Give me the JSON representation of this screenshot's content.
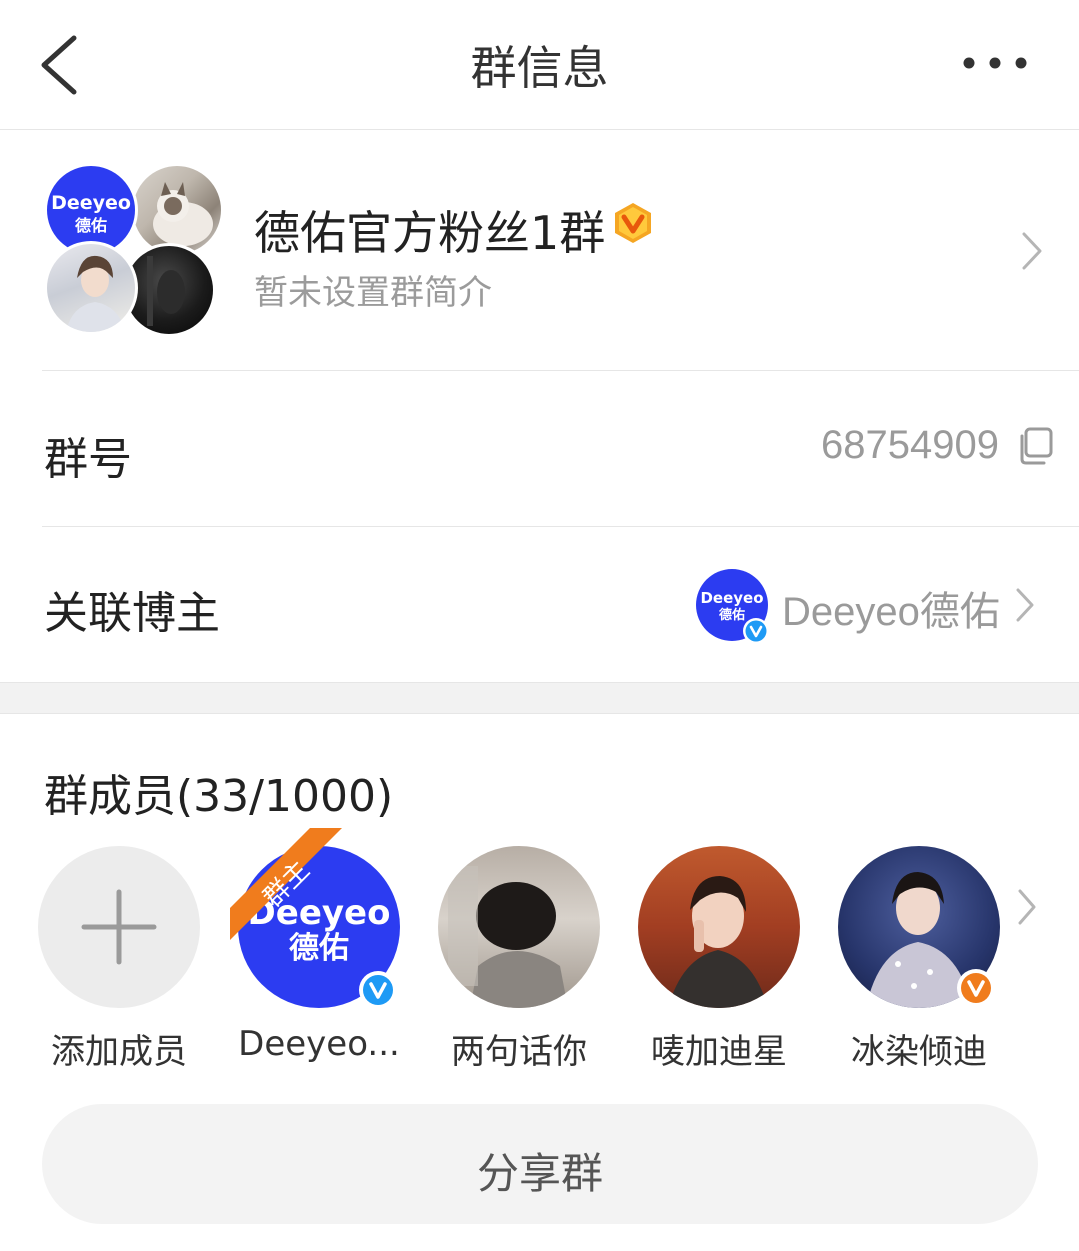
{
  "header": {
    "title": "群信息",
    "back_icon": "chevron-left-icon",
    "more_icon": "more-dots-icon"
  },
  "group": {
    "name": "德佑官方粉丝1群",
    "description": "暂未设置群简介",
    "badge_icon": "vip-v-badge-icon",
    "badge_color": "#f5a623",
    "avatar_brand_line1": "Deeyeo",
    "avatar_brand_line2": "德佑"
  },
  "group_number": {
    "label": "群号",
    "value": "68754909",
    "icon": "copy-icon"
  },
  "linked_blogger": {
    "label": "关联博主",
    "name": "Deeyeo德佑",
    "avatar_line1": "Deeyeo",
    "avatar_line2": "德佑",
    "verified_color": "#1e9af5"
  },
  "members": {
    "title": "群成员(33/1000)",
    "items": [
      {
        "name": "添加成员",
        "type": "add"
      },
      {
        "name": "Deeyeo...",
        "role": "群主",
        "brand_line1": "Deeyeo",
        "brand_line2": "德佑",
        "badge": "verified-blue"
      },
      {
        "name": "两句话你"
      },
      {
        "name": "唛加迪星"
      },
      {
        "name": "冰染倾迪",
        "badge": "verified-orange"
      }
    ]
  },
  "share": {
    "label": "分享群"
  },
  "colors": {
    "brand_blue": "#2c3cf1",
    "ribbon_orange": "#f07c1d",
    "gray_text": "#9a9a9a"
  }
}
